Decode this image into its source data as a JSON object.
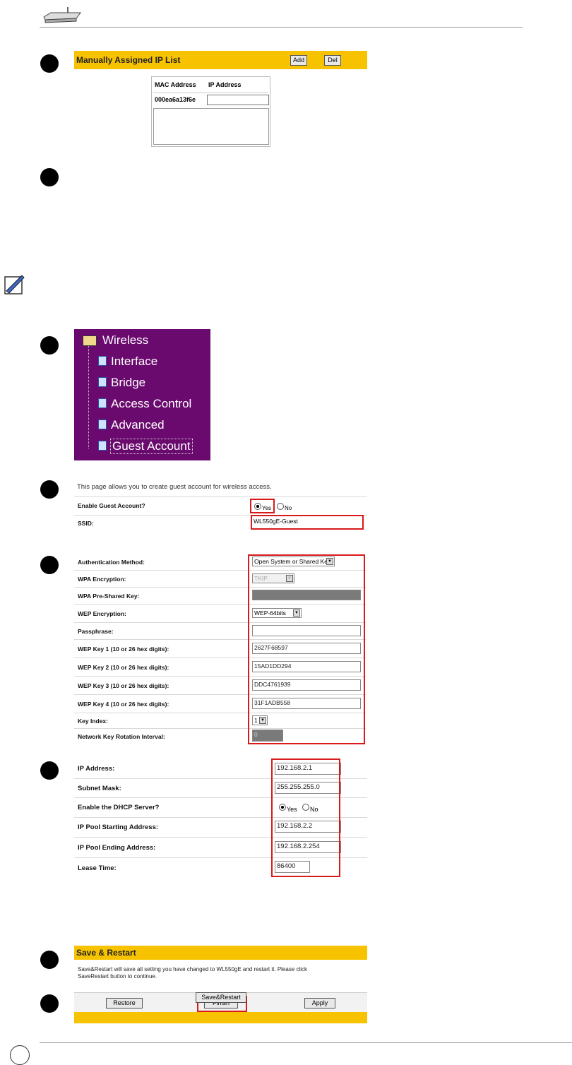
{
  "ip_list": {
    "title": "Manually Assigned IP List",
    "add_label": "Add",
    "del_label": "Del",
    "col_mac": "MAC Address",
    "col_ip": "IP Address",
    "mac_value": "000ea6a13f6e"
  },
  "wireless_menu": {
    "root": "Wireless",
    "items": [
      "Interface",
      "Bridge",
      "Access Control",
      "Advanced",
      "Guest Account"
    ]
  },
  "guest": {
    "intro": "This page allows you to create guest account for wireless access.",
    "enable_label": "Enable Guest Account?",
    "yes": "Yes",
    "no": "No",
    "ssid_label": "SSID:",
    "ssid_value": "WL550gE-Guest"
  },
  "security": {
    "rows": [
      {
        "label": "Authentication Method:",
        "value": "Open System or Shared Key"
      },
      {
        "label": "WPA Encryption:",
        "value": "TKIP"
      },
      {
        "label": "WPA Pre-Shared Key:",
        "value": ""
      },
      {
        "label": "WEP Encryption:",
        "value": "WEP-64bits"
      },
      {
        "label": "Passphrase:",
        "value": ""
      },
      {
        "label": "WEP Key 1 (10 or 26 hex digits):",
        "value": "2627F68597"
      },
      {
        "label": "WEP Key 2 (10 or 26 hex digits):",
        "value": "15AD1DD294"
      },
      {
        "label": "WEP Key 3 (10 or 26 hex digits):",
        "value": "DDC4761939"
      },
      {
        "label": "WEP Key 4 (10 or 26 hex digits):",
        "value": "31F1ADB558"
      },
      {
        "label": "Key Index:",
        "value": "1"
      },
      {
        "label": "Network Key Rotation Interval:",
        "value": "0"
      }
    ]
  },
  "lan": {
    "rows": [
      {
        "label": "IP Address:",
        "value": "192.168.2.1"
      },
      {
        "label": "Subnet Mask:",
        "value": "255.255.255.0"
      },
      {
        "label": "Enable the DHCP Server?",
        "value": ""
      },
      {
        "label": "IP Pool Starting Address:",
        "value": "192.168.2.2"
      },
      {
        "label": "IP Pool Ending Address:",
        "value": "192.168.2.254"
      },
      {
        "label": "Lease Time:",
        "value": "86400"
      }
    ],
    "yes": "Yes",
    "no": "No"
  },
  "buttons": {
    "restore": "Restore",
    "finish": "Finish",
    "apply": "Apply"
  },
  "save": {
    "title": "Save & Restart",
    "text1": "Save&Restart will save all setting you have changed to WL550gE and restart it. Please click",
    "text2": "SaveRestart button to continue.",
    "button": "Save&Restart"
  }
}
